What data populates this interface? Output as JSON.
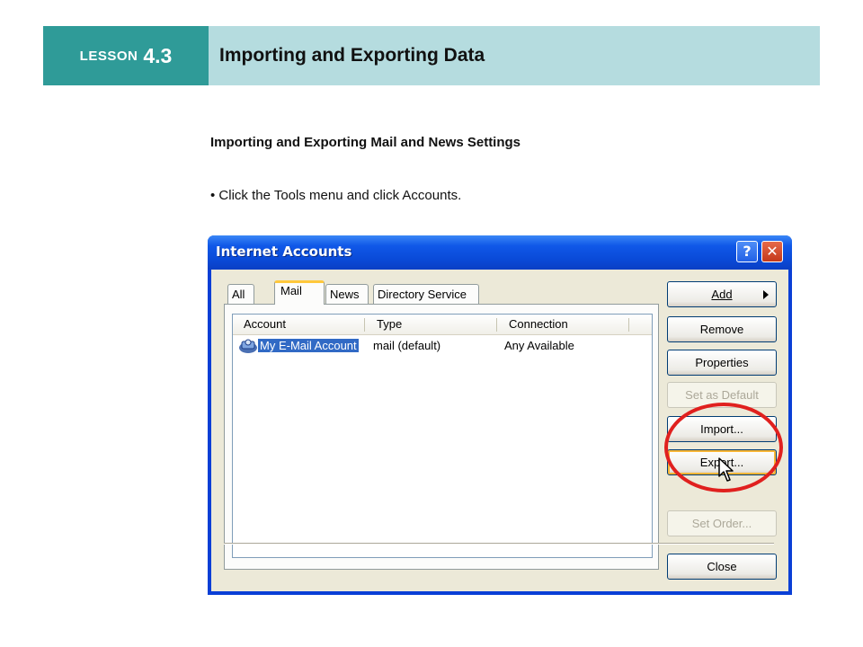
{
  "lesson": {
    "word": "LESSON",
    "number": "4.3",
    "title": "Importing and Exporting Data"
  },
  "content": {
    "subtitle": "Importing and Exporting Mail and News Settings",
    "instruction": "• Click the Tools menu and click Accounts."
  },
  "dialog": {
    "title": "Internet Accounts",
    "help_icon": "?",
    "close_icon": "✕",
    "tabs": [
      {
        "label": "All"
      },
      {
        "label": "Mail"
      },
      {
        "label": "News"
      },
      {
        "label": "Directory Service"
      }
    ],
    "active_tab": "Mail",
    "columns": [
      "Account",
      "Type",
      "Connection"
    ],
    "rows": [
      {
        "account": "My E-Mail Account",
        "type": "mail (default)",
        "connection": "Any Available",
        "icon": "mail-account-icon"
      }
    ],
    "buttons": {
      "add": "Add",
      "remove": "Remove",
      "properties": "Properties",
      "set_default": "Set as Default",
      "import": "Import...",
      "export": "Export...",
      "set_order": "Set Order...",
      "close": "Close"
    }
  },
  "colors": {
    "lesson_teal": "#2f9b98",
    "title_band": "#b5dcdf",
    "highlight_circle": "#e0201e",
    "selection": "#316ac5"
  }
}
